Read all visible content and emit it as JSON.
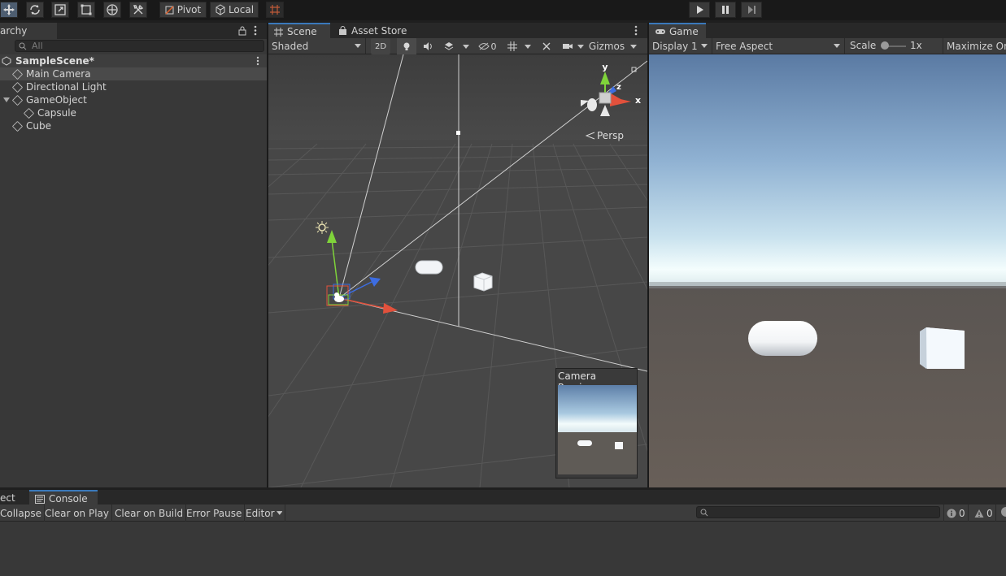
{
  "toolbar": {
    "pivot_label": "Pivot",
    "local_label": "Local"
  },
  "hierarchy": {
    "tab_label": "archy",
    "search_placeholder": "All",
    "scene_name": "SampleScene*",
    "items": [
      {
        "label": "Main Camera"
      },
      {
        "label": "Directional Light"
      },
      {
        "label": "GameObject"
      },
      {
        "label": "Capsule"
      },
      {
        "label": "Cube"
      }
    ]
  },
  "scene": {
    "tab_label": "Scene",
    "asset_store_label": "Asset Store",
    "shading_mode": "Shaded",
    "mode_2d": "2D",
    "hidden_count": "0",
    "gizmos_label": "Gizmos",
    "persp_label": "Persp",
    "axis_x": "x",
    "axis_y": "y",
    "axis_z": "z",
    "camera_preview_label": "Camera Preview"
  },
  "game": {
    "tab_label": "Game",
    "display_label": "Display 1",
    "aspect_label": "Free Aspect",
    "scale_label": "Scale",
    "scale_value": "1x",
    "maximize_label": "Maximize On"
  },
  "console": {
    "project_tab_label": "ect",
    "tab_label": "Console",
    "collapse_label": "Collapse",
    "clear_on_play_label": "Clear on Play",
    "clear_on_build_label": "Clear on Build",
    "error_pause_label": "Error Pause",
    "editor_label": "Editor",
    "log_count": "0",
    "warning_count": "0"
  },
  "colors": {
    "accent": "#3a79bb",
    "panel": "#383838",
    "toolbar": "#191919",
    "sky_top": "#5e7ea5",
    "ground": "#5f5a55"
  }
}
